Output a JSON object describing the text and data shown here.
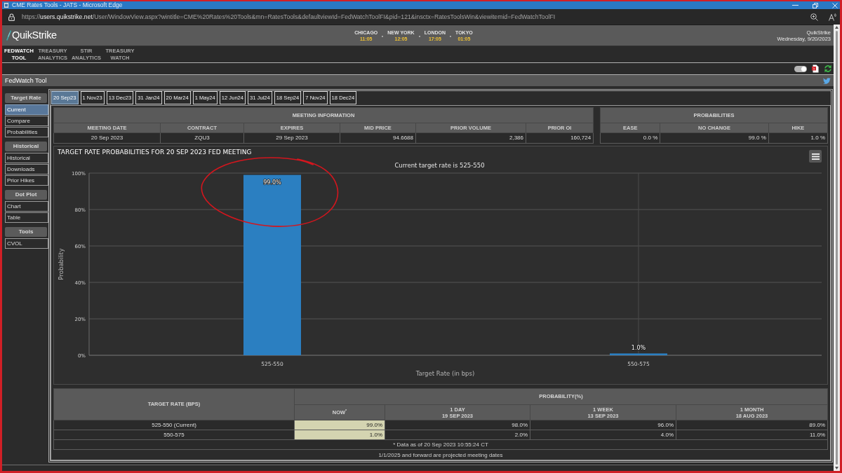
{
  "window": {
    "title": "CME Rates Tools - JATS - Microsoft Edge"
  },
  "address_bar": {
    "scheme": "https://",
    "host": "users.quikstrike.net",
    "path": "/User/WindowView.aspx?wintitle=CME%20Rates%20Tools&mn=RatesTools&defaultviewId=FedWatchToolFI&pid=121&insctx=RatesToolsWin&viewitemid=FedWatchToolFI"
  },
  "header": {
    "logo": "QuikStrike",
    "clocks": [
      {
        "city": "CHICAGO",
        "time": "11:05"
      },
      {
        "city": "NEW YORK",
        "time": "12:05"
      },
      {
        "city": "LONDON",
        "time": "17:05"
      },
      {
        "city": "TOKYO",
        "time": "01:05"
      }
    ],
    "brand": "QuikStrike",
    "date": "Wednesday, 9/20/2023"
  },
  "nav": [
    {
      "label": "FEDWATCH TOOL",
      "selected": true
    },
    {
      "label": "TREASURY ANALYTICS",
      "selected": false
    },
    {
      "label": "STIR ANALYTICS",
      "selected": false
    },
    {
      "label": "TREASURY WATCH",
      "selected": false
    }
  ],
  "toolbar": {
    "toggle": {
      "on": true
    }
  },
  "page_title": "FedWatch Tool",
  "sidebar": [
    {
      "heading": "Target Rate",
      "items": [
        {
          "label": "Current",
          "selected": true
        },
        {
          "label": "Compare",
          "selected": false
        },
        {
          "label": "Probabilities",
          "selected": false
        }
      ]
    },
    {
      "heading": "Historical",
      "items": [
        {
          "label": "Historical",
          "selected": false
        },
        {
          "label": "Downloads",
          "selected": false
        },
        {
          "label": "Prior Hikes",
          "selected": false
        }
      ]
    },
    {
      "heading": "Dot Plot",
      "items": [
        {
          "label": "Chart",
          "selected": false
        },
        {
          "label": "Table",
          "selected": false
        }
      ]
    },
    {
      "heading": "Tools",
      "items": [
        {
          "label": "CVOL",
          "selected": false
        }
      ]
    }
  ],
  "meeting_tabs": [
    {
      "label": "20 Sep23",
      "selected": true
    },
    {
      "label": "1 Nov23",
      "selected": false
    },
    {
      "label": "13 Dec23",
      "selected": false
    },
    {
      "label": "31 Jan24",
      "selected": false
    },
    {
      "label": "20 Mar24",
      "selected": false
    },
    {
      "label": "1 May24",
      "selected": false
    },
    {
      "label": "12 Jun24",
      "selected": false
    },
    {
      "label": "31 Jul24",
      "selected": false
    },
    {
      "label": "18 Sep24",
      "selected": false
    },
    {
      "label": "7 Nov24",
      "selected": false
    },
    {
      "label": "18 Dec24",
      "selected": false
    }
  ],
  "meeting_info": {
    "title": "MEETING INFORMATION",
    "columns": [
      {
        "label": "MEETING DATE",
        "kind": "text"
      },
      {
        "label": "CONTRACT",
        "kind": "text"
      },
      {
        "label": "EXPIRES",
        "kind": "text"
      },
      {
        "label": "MID PRICE",
        "kind": "number"
      },
      {
        "label": "PRIOR VOLUME",
        "kind": "number"
      },
      {
        "label": "PRIOR OI",
        "kind": "number"
      }
    ],
    "row": [
      "20 Sep 2023",
      "ZQU3",
      "29 Sep 2023",
      "94.6688",
      "2,386",
      "160,724"
    ]
  },
  "probabilities": {
    "title": "PROBABILITIES",
    "columns": [
      {
        "label": "EASE",
        "kind": "number"
      },
      {
        "label": "NO CHANGE",
        "kind": "number"
      },
      {
        "label": "HIKE",
        "kind": "number"
      }
    ],
    "row": [
      "0.0 %",
      "99.0 %",
      "1.0 %"
    ]
  },
  "chart_panel": {
    "heading": "TARGET RATE PROBABILITIES FOR 20 SEP 2023 FED MEETING",
    "chart_data": {
      "type": "bar",
      "title": "Current target rate is 525-550",
      "xlabel": "Target Rate (in bps)",
      "ylabel": "Probability",
      "categories": [
        "525-550",
        "550-575"
      ],
      "values": [
        99.0,
        1.0
      ],
      "ylim": [
        0,
        100
      ],
      "yticks": [
        {
          "value": 0,
          "label": "0%"
        },
        {
          "value": 20,
          "label": "20%"
        },
        {
          "value": 40,
          "label": "40%"
        },
        {
          "value": 60,
          "label": "60%"
        },
        {
          "value": 80,
          "label": "80%"
        },
        {
          "value": 100,
          "label": "100%"
        }
      ],
      "grid": true,
      "ref_lines": [
        {
          "axis": "x",
          "value": "550-575"
        }
      ],
      "value_labels": [
        "99.0%",
        "1.0%"
      ]
    }
  },
  "user_markup": [
    {
      "kind": "circle"
    }
  ],
  "probability_table": {
    "row_header": "TARGET RATE (BPS)",
    "group_header": "PROBABILITY(%)",
    "columns": [
      {
        "label": "NOW$^{*}$",
        "highlighted": true
      },
      {
        "label": "1 DAY",
        "date": "19 SEP 2023",
        "highlighted": false
      },
      {
        "label": "1 WEEK",
        "date": "13 SEP 2023",
        "highlighted": false
      },
      {
        "label": "1 MONTH",
        "date": "18 AUG 2023",
        "highlighted": false
      }
    ],
    "rows": [
      {
        "target": "525-550 (Current)",
        "values": [
          "99.0%",
          "98.0%",
          "96.0%",
          "89.0%"
        ]
      },
      {
        "target": "550-575",
        "values": [
          "1.0%",
          "2.0%",
          "4.0%",
          "11.0%"
        ]
      }
    ],
    "footnote": "* Data as of 20 Sep 2023 10:55:24 CT"
  },
  "note": "1/1/2025 and forward are projected meeting dates"
}
